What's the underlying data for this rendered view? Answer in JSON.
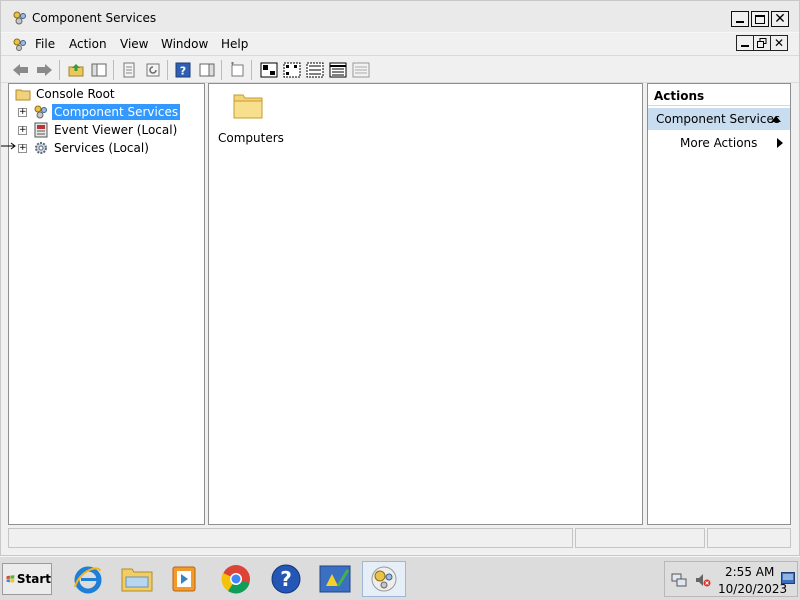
{
  "window": {
    "title": "Component Services",
    "icon": "component-services-icon"
  },
  "menubar": {
    "items": [
      "File",
      "Action",
      "View",
      "Window",
      "Help"
    ]
  },
  "toolbar": {
    "buttons": [
      "back-icon",
      "forward-icon",
      "up-folder-icon",
      "show-hide-tree-icon",
      "properties-icon",
      "refresh-icon",
      "help-icon",
      "show-hide-action-pane-icon",
      "new-window-icon",
      "large-icons-icon",
      "small-icons-icon",
      "list-view-icon",
      "details-view-icon",
      "configure-icon"
    ]
  },
  "tree": {
    "root": "Console Root",
    "items": [
      {
        "label": "Component Services",
        "selected": true
      },
      {
        "label": "Event Viewer (Local)",
        "selected": false
      },
      {
        "label": "Services (Local)",
        "selected": false
      }
    ]
  },
  "content": {
    "items": [
      {
        "label": "Computers",
        "icon": "folder-icon"
      }
    ]
  },
  "actions": {
    "header": "Actions",
    "section": "Component Services",
    "items": [
      "More Actions"
    ]
  },
  "taskbar": {
    "start_label": "Start",
    "apps": [
      "internet-explorer-icon",
      "file-explorer-icon",
      "media-player-icon",
      "chrome-icon",
      "help-icon",
      "action-center-icon",
      "component-services-icon"
    ],
    "clock_time": "2:55 AM",
    "clock_date": "10/20/2023"
  },
  "colors": {
    "selection": "#3399ff",
    "actions_section_bg": "#c9ddf1"
  }
}
